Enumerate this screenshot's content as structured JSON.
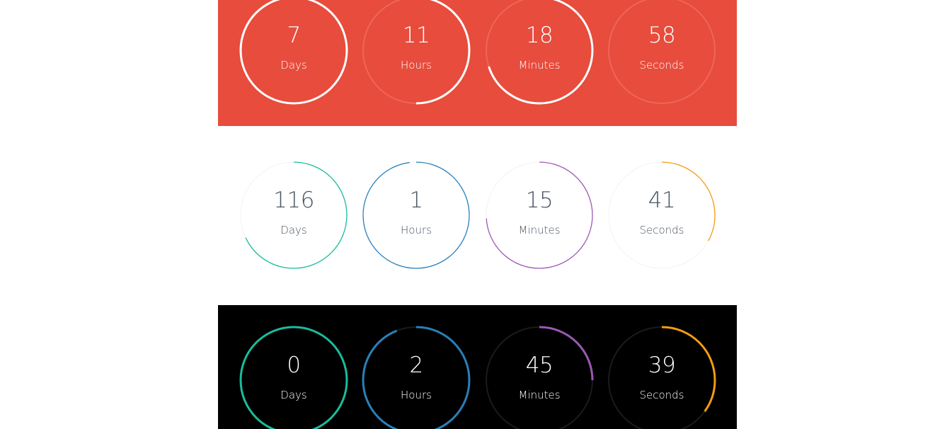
{
  "panels": [
    {
      "theme": "red",
      "track_color": "#ef6658",
      "timers": [
        {
          "value": "7",
          "label": "Days",
          "progress": 1.0,
          "color": "#ffffff"
        },
        {
          "value": "11",
          "label": "Hours",
          "progress": 0.5,
          "color": "#ffffff"
        },
        {
          "value": "18",
          "label": "Minutes",
          "progress": 0.7,
          "color": "#ffffff"
        },
        {
          "value": "58",
          "label": "Seconds",
          "progress": 0.0,
          "color": "#ffffff"
        }
      ]
    },
    {
      "theme": "white",
      "track_color": "#f3f3f3",
      "timers": [
        {
          "value": "116",
          "label": "Days",
          "progress": 0.68,
          "color": "#1abc9c"
        },
        {
          "value": "1",
          "label": "Hours",
          "progress": 0.98,
          "color": "#2980b9"
        },
        {
          "value": "15",
          "label": "Minutes",
          "progress": 0.74,
          "color": "#9b59b6"
        },
        {
          "value": "41",
          "label": "Seconds",
          "progress": 0.33,
          "color": "#f39c12"
        }
      ]
    },
    {
      "theme": "black",
      "track_color": "#1b1b1b",
      "timers": [
        {
          "value": "0",
          "label": "Days",
          "progress": 1.0,
          "color": "#1abc9c"
        },
        {
          "value": "2",
          "label": "Hours",
          "progress": 0.94,
          "color": "#2980b9"
        },
        {
          "value": "45",
          "label": "Minutes",
          "progress": 0.25,
          "color": "#9b59b6"
        },
        {
          "value": "39",
          "label": "Seconds",
          "progress": 0.35,
          "color": "#f39c12"
        }
      ]
    }
  ]
}
